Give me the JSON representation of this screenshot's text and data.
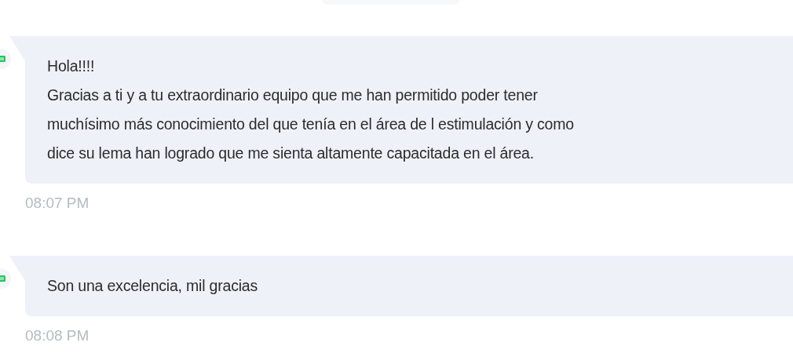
{
  "messages": [
    {
      "lines": [
        "Hola!!!!",
        "Gracias a ti y a tu extraordinario equipo que me han permitido poder tener",
        "muchísimo más conocimiento del que tenía en el área de l estimulación y como",
        "dice su lema han logrado que me sienta altamente capacitada en el área."
      ],
      "time": "08:07 PM"
    },
    {
      "lines": [
        "Son una excelencia, mil gracias"
      ],
      "time": "08:08 PM"
    }
  ]
}
